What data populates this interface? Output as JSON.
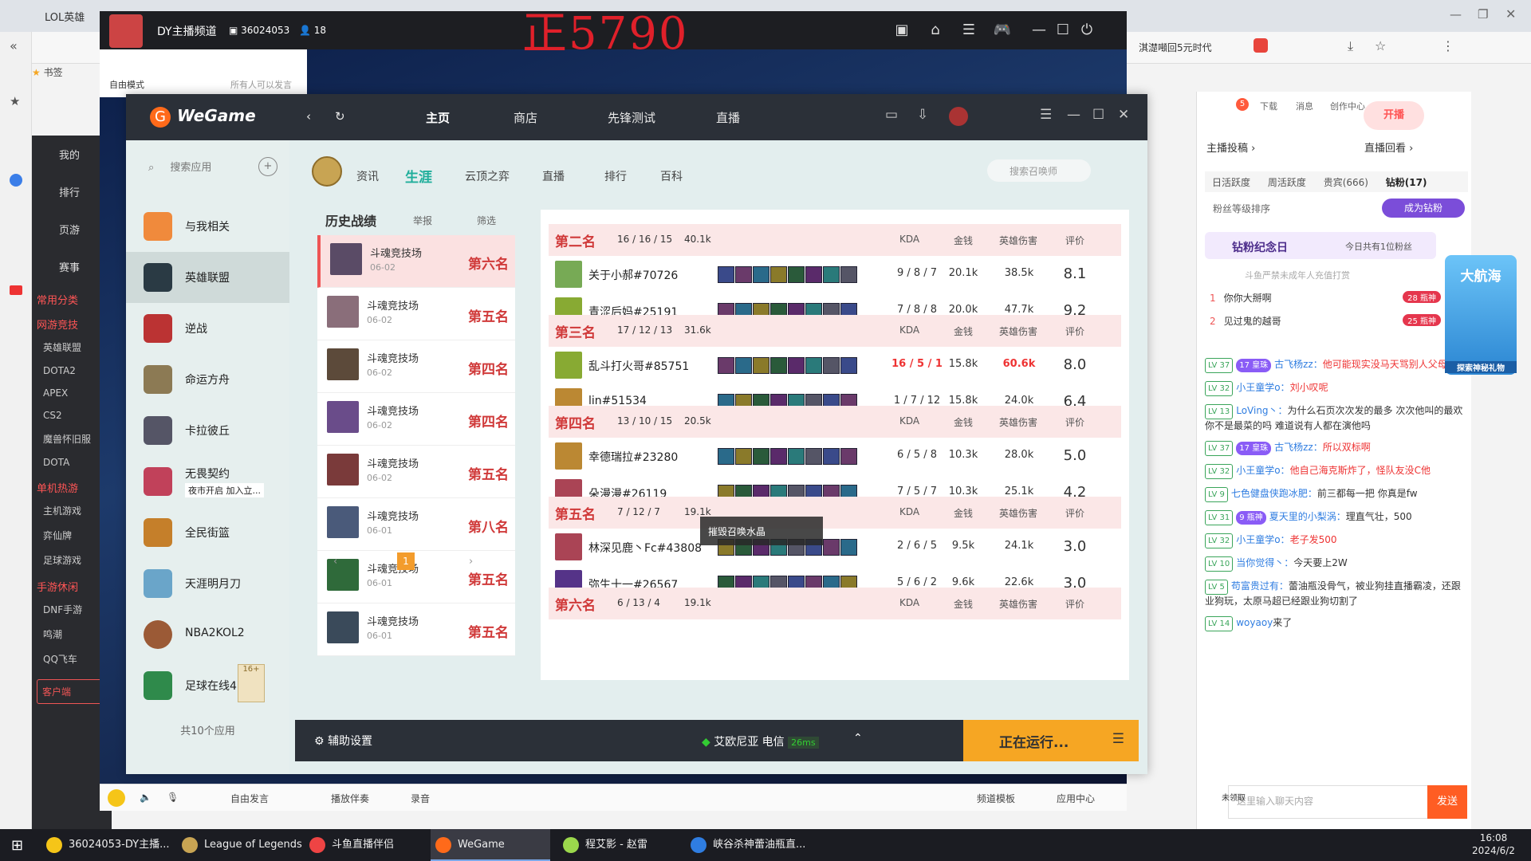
{
  "browser": {
    "tab_title": "LOL英雄",
    "address_suffix": "淇濋噸回5元时代",
    "bookmarks_label": "书签"
  },
  "douyu_left": {
    "top_items": [
      "我的",
      "排行",
      "页游",
      "赛事"
    ],
    "sections": [
      {
        "title": "常用分类",
        "items": []
      },
      {
        "title": "网游竞技",
        "items": [
          "英雄联盟",
          "DOTA2",
          "APEX",
          "CS2",
          "魔兽怀旧服",
          "DOTA"
        ]
      },
      {
        "title": "单机热游",
        "items": [
          "主机游戏",
          "弈仙牌",
          "足球游戏"
        ]
      },
      {
        "title": "手游休闲",
        "items": [
          "DNF手游",
          "鸣潮",
          "QQ飞车"
        ]
      }
    ],
    "customer_service": "客户端"
  },
  "dy_bar": {
    "title": "DY主播频道",
    "room": "36024053",
    "viewers": "18",
    "big_text": "正5790"
  },
  "stream_side": {
    "mode": "自由模式",
    "hint": "所有人可以发言"
  },
  "chat": {
    "header_icons": [
      "下载",
      "消息",
      "创作中心"
    ],
    "message_badge": "5",
    "open_live": "开播",
    "subheader": [
      "主播投稿",
      "直播回看"
    ],
    "tabs": [
      "日活跃度",
      "周活跃度",
      "贵宾(666)",
      "钻粉(17)"
    ],
    "fan_rank_label": "粉丝等级排序",
    "become_diamond": "成为钻粉",
    "diamond_day": "钻粉纪念日",
    "diamond_day_right": "今日共有1位粉丝",
    "disclaimer": "斗鱼严禁未成年人充值打赏",
    "rank_list": [
      {
        "n": "1",
        "name": "你你大掰啊",
        "lv": "28",
        "tag": "瓶神"
      },
      {
        "n": "2",
        "name": "见过鬼的越哥",
        "lv": "25",
        "tag": "瓶神"
      }
    ],
    "messages": [
      {
        "lv": "LV 37",
        "badge": "17 皇珠",
        "user": "古飞杨zz：",
        "text": "他可能现实没马天骂别人父母",
        "red": true
      },
      {
        "lv": "LV 32",
        "badge": "",
        "user": "小王童学o：",
        "text": "刘小叹呢",
        "red": true
      },
      {
        "lv": "LV 13",
        "badge": "",
        "user": "LoVing丶：",
        "text": "为什么石页次次发的最多 次次他叫的最欢 你不是最菜的吗 难道说有人都在演他吗",
        "red": false
      },
      {
        "lv": "LV 37",
        "badge": "17 皇珠",
        "user": "古飞杨zz：",
        "text": "所以双标啊",
        "red": true
      },
      {
        "lv": "LV 32",
        "badge": "",
        "user": "小王童学o：",
        "text": "他自己海克斯炸了，怪队友没C他",
        "red": true
      },
      {
        "lv": "LV 9",
        "badge": "",
        "user": "七色健盘侠跑冰肥：",
        "text": "前三都每一把 你真是fw",
        "red": false
      },
      {
        "lv": "LV 31",
        "badge": "9 瓶神",
        "user": "夏天里的小梨涡：",
        "text": "理直气壮，500",
        "red": false
      },
      {
        "lv": "LV 32",
        "badge": "",
        "user": "小王童学o：",
        "text": "老子发500",
        "red": true
      },
      {
        "lv": "LV 10",
        "badge": "",
        "user": "当你觉得丶：",
        "text": "今天要上2W",
        "red": false
      },
      {
        "lv": "LV 5",
        "badge": "",
        "user": "苟富贵过有：",
        "text": "蕾油瓶没骨气，被业狗挂直播霸凌，还跟业狗玩，太原马超已经跟业狗切割了",
        "red": false
      },
      {
        "lv": "LV 14",
        "badge": "",
        "user": "woyaoy",
        "text": "来了",
        "red": false
      }
    ],
    "ship_ad": "大航海",
    "ship_ad_sub": "探索神秘礼物",
    "input_placeholder": "这里输入聊天内容",
    "send": "发送",
    "not_login": "未领取"
  },
  "wegame": {
    "logo": "WeGame",
    "nav": [
      "主页",
      "商店",
      "先锋测试",
      "直播"
    ],
    "side_search": "搜索应用",
    "apps": [
      "与我相关",
      "英雄联盟",
      "逆战",
      "命运方舟",
      "卡拉彼丘",
      "无畏契约",
      "全民街篮",
      "天涯明月刀",
      "NBA2KOL2",
      "足球在线4（F..."
    ],
    "valorant_sub": "夜市开启 加入立...",
    "apps_total": "共10个应用",
    "lol_tabs": [
      "资讯",
      "生涯",
      "云顶之弈",
      "直播",
      "排行",
      "百科"
    ],
    "lol_search": "搜索召唤师",
    "history_title": "历史战绩",
    "report": "举报",
    "filter": "筛选",
    "history": [
      {
        "mode": "斗魂竞技场",
        "date": "06-02",
        "rank": "第六名"
      },
      {
        "mode": "斗魂竞技场",
        "date": "06-02",
        "rank": "第五名"
      },
      {
        "mode": "斗魂竞技场",
        "date": "06-02",
        "rank": "第四名"
      },
      {
        "mode": "斗魂竞技场",
        "date": "06-02",
        "rank": "第四名"
      },
      {
        "mode": "斗魂竞技场",
        "date": "06-02",
        "rank": "第五名"
      },
      {
        "mode": "斗魂竞技场",
        "date": "06-01",
        "rank": "第八名"
      },
      {
        "mode": "斗魂竞技场",
        "date": "06-01",
        "rank": "第五名"
      },
      {
        "mode": "斗魂竞技场",
        "date": "06-01",
        "rank": "第五名"
      }
    ],
    "page": "1",
    "col_headers": [
      "KDA",
      "金钱",
      "英雄伤害",
      "评价"
    ],
    "teams": [
      {
        "place": "第二名",
        "kda": "16 / 16 / 15",
        "gold": "40.1k",
        "players": [
          {
            "name": "关于小郝#70726",
            "kda": "9 / 8 / 7",
            "gold": "20.1k",
            "dmg": "38.5k",
            "score": "8.1"
          },
          {
            "name": "青涩后妈#25191",
            "kda": "7 / 8 / 8",
            "gold": "20.0k",
            "dmg": "47.7k",
            "score": "9.2"
          }
        ]
      },
      {
        "place": "第三名",
        "kda": "17 / 12 / 13",
        "gold": "31.6k",
        "players": [
          {
            "name": "乱斗打火哥#85751",
            "kda": "16 / 5 / 1",
            "gold": "15.8k",
            "dmg": "60.6k",
            "score": "8.0"
          },
          {
            "name": "lin#51534",
            "kda": "1 / 7 / 12",
            "gold": "15.8k",
            "dmg": "24.0k",
            "score": "6.4"
          }
        ]
      },
      {
        "place": "第四名",
        "kda": "13 / 10 / 15",
        "gold": "20.5k",
        "players": [
          {
            "name": "幸德瑞拉#23280",
            "kda": "6 / 5 / 8",
            "gold": "10.3k",
            "dmg": "28.0k",
            "score": "5.0"
          },
          {
            "name": "朵漫漫#26119",
            "kda": "7 / 5 / 7",
            "gold": "10.3k",
            "dmg": "25.1k",
            "score": "4.2"
          }
        ]
      },
      {
        "place": "第五名",
        "kda": "7 / 12 / 7",
        "gold": "19.1k",
        "players": [
          {
            "name": "林深见鹿丶Fc#43808",
            "kda": "2 / 6 / 5",
            "gold": "9.5k",
            "dmg": "24.1k",
            "score": "3.0"
          },
          {
            "name": "弥生十一#26567",
            "kda": "5 / 6 / 2",
            "gold": "9.6k",
            "dmg": "22.6k",
            "score": "3.0"
          }
        ]
      },
      {
        "place": "第六名",
        "kda": "6 / 13 / 4",
        "gold": "19.1k",
        "players": []
      }
    ],
    "tooltip": "摧毁召唤水晶",
    "assist": "辅助设置",
    "server": "艾欧尼亚 电信",
    "ping": "26ms",
    "running": "正在运行...",
    "age": "16+"
  },
  "dy_bottom": [
    "自由发言",
    "播放伴奏",
    "录音",
    "频道模板",
    "应用中心"
  ],
  "taskbar": {
    "items": [
      "36024053-DY主播...",
      "League of Legends",
      "斗鱼直播伴侣",
      "WeGame",
      "程艾影 - 赵雷",
      "峡谷杀神蕾油瓶直..."
    ],
    "time": "16:08",
    "date": "2024/6/2"
  }
}
